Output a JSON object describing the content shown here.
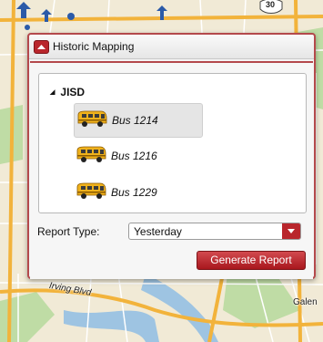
{
  "map": {
    "labels": {
      "street": "Irving Blvd",
      "place": "Galen",
      "highway_shield": "30"
    },
    "colors": {
      "land": "#f1ead6",
      "road_major": "#f2b33b",
      "road_minor": "#ffffff",
      "water": "#9ec4e2",
      "park": "#bfdca5"
    }
  },
  "panel": {
    "title": "Historic Mapping",
    "collapse_icon": "chevron-up-icon",
    "tree": {
      "root_label": "JISD",
      "items": [
        {
          "label": "Bus 1214",
          "selected": true,
          "icon": "school-bus-icon"
        },
        {
          "label": "Bus 1216",
          "selected": false,
          "icon": "school-bus-icon"
        },
        {
          "label": "Bus 1229",
          "selected": false,
          "icon": "school-bus-icon"
        }
      ]
    },
    "report_type": {
      "label": "Report Type:",
      "value": "Yesterday"
    },
    "generate_label": "Generate Report",
    "accent_color": "#b9262c"
  }
}
